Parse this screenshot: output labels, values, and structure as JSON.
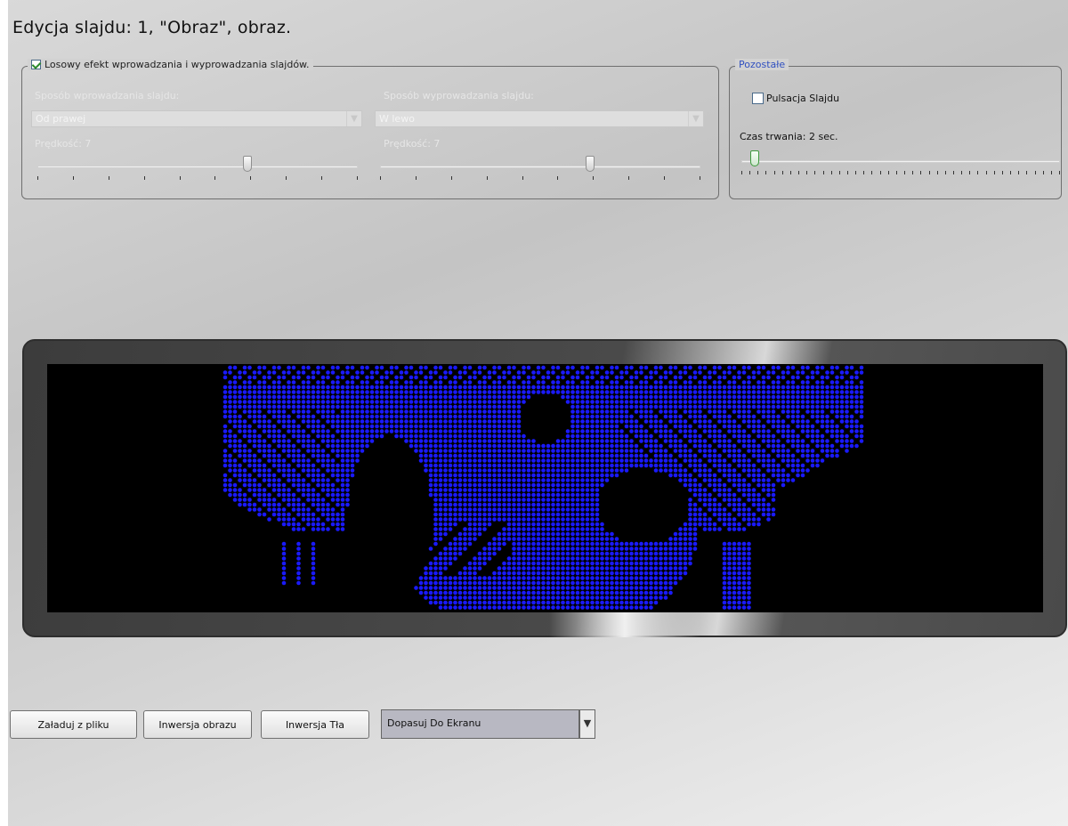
{
  "title": "Edycja slajdu: 1, \"Obraz\", obraz.",
  "transition_group": {
    "legend": "Losowy efekt wprowadzania i wyprowadzania slajdów.",
    "checked": true,
    "in_label": "Sposób wprowadzania slajdu:",
    "in_value": "Od prawej",
    "out_label": "Sposób wyprowadzania slajdu:",
    "out_value": "W lewo",
    "in_speed_label": "Prędkość: 7",
    "out_speed_label": "Prędkość: 7",
    "in_speed_level": 0.66,
    "out_speed_level": 0.66
  },
  "other_group": {
    "legend": "Pozostałe",
    "pulse_label": "Pulsacja Slajdu",
    "pulse_checked": false,
    "duration_label": "Czas trwania: 2 sec.",
    "duration_level": 0.03
  },
  "colors": {
    "led": "#1a1aff",
    "legend_accent": "#3050c0"
  },
  "buttons": {
    "load": "Załaduj z pliku",
    "invert_image": "Inwersja obrazu",
    "invert_bg": "Inwersja Tła"
  },
  "fit_select": {
    "value": "Dopasuj Do Ekranu"
  }
}
